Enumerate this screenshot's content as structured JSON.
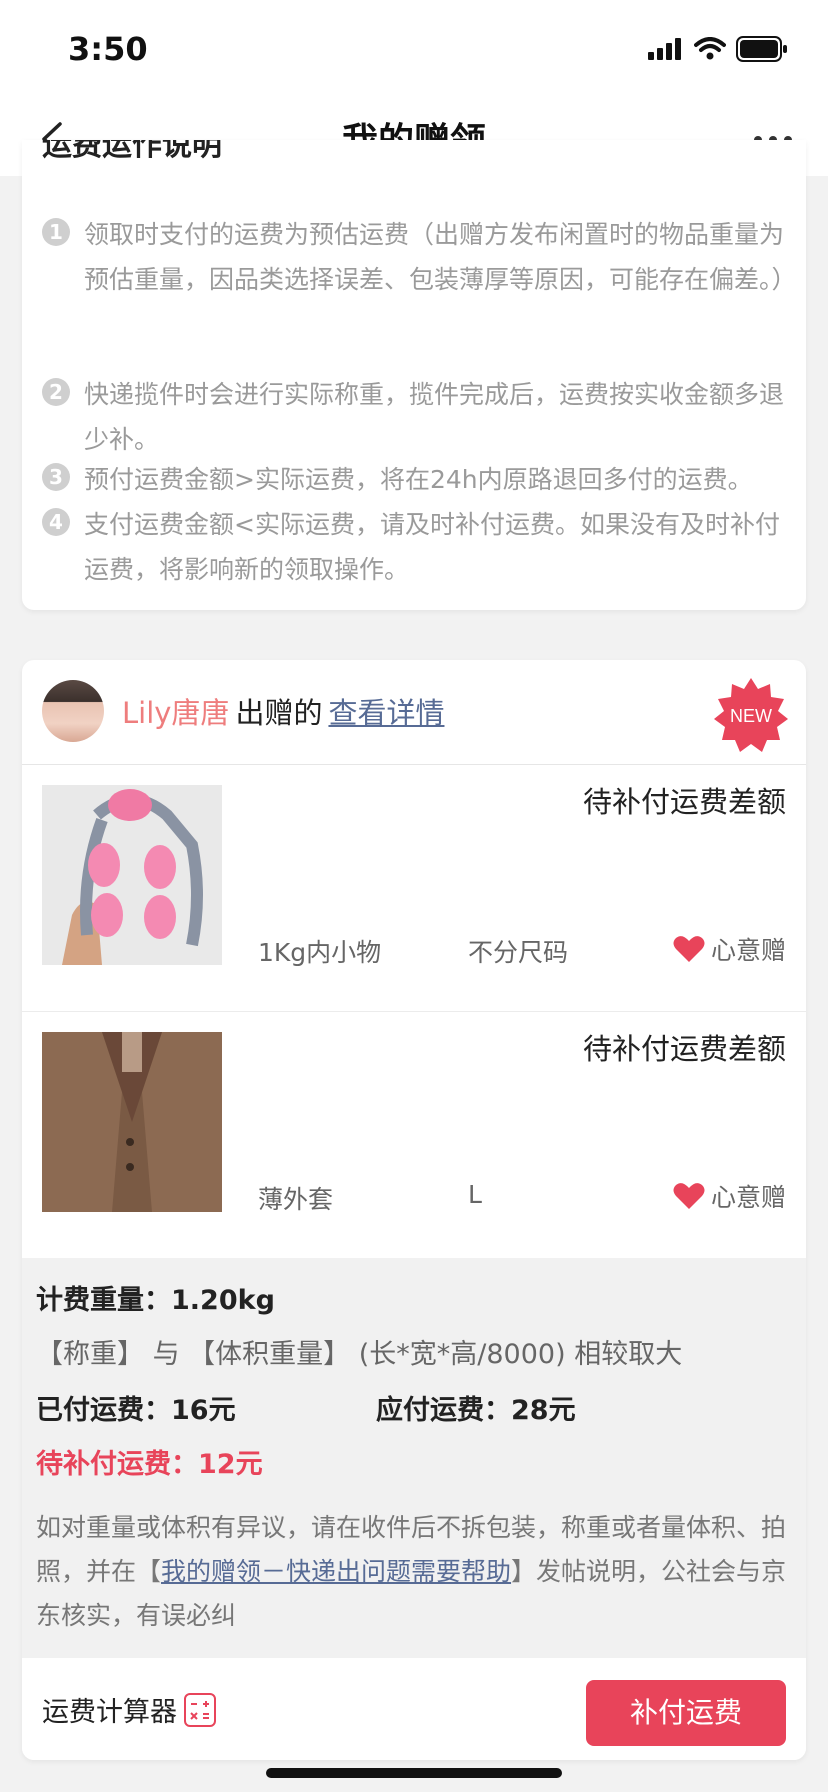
{
  "status_bar": {
    "time": "3:50"
  },
  "nav": {
    "title": "我的赠领"
  },
  "shipping_notes": {
    "title": "运费运作说明",
    "items": [
      {
        "num": "1",
        "text": "领取时支付的运费为预估运费（出赠方发布闲置时的物品重量为预估重量，因品类选择误差、包装薄厚等原因，可能存在偏差。）"
      },
      {
        "num": "2",
        "text": "快递揽件时会进行实际称重，揽件完成后，运费按实收金额多退少补。"
      },
      {
        "num": "3",
        "text": "预付运费金额>实际运费，将在24h内原路退回多付的运费。"
      },
      {
        "num": "4",
        "text": "支付运费金额<实际运费，请及时补付运费。如果没有及时补付运费，将影响新的领取操作。"
      }
    ]
  },
  "order": {
    "donor_name": "Lily唐唐",
    "donor_suffix": "出赠的",
    "detail_link": "查看详情",
    "badge": "NEW",
    "items": [
      {
        "status": "待补付运费差额",
        "name": "1Kg内小物",
        "size": "不分尺码",
        "tag": "心意赠"
      },
      {
        "status": "待补付运费差额",
        "name": "薄外套",
        "size": "L",
        "tag": "心意赠"
      }
    ],
    "fee": {
      "billing_weight_label": "计费重量：",
      "billing_weight": "1.20kg",
      "weight_rule": "【称重】 与 【体积重量】 (长*宽*高/8000) 相较取大",
      "paid_label": "已付运费：",
      "paid": "16元",
      "due_label": "应付运费：",
      "due": "28元",
      "pending_label": "待补付运费：",
      "pending": "12元",
      "desc_before": "如对重量或体积有异议，请在收件后不拆包装，称重或者量体积、拍照，并在【",
      "desc_link": "我的赠领－快递出问题需要帮助",
      "desc_after": "】发帖说明，公社会与京东核实，有误必纠"
    },
    "calculator_label": "运费计算器",
    "pay_button": "补付运费"
  },
  "colors": {
    "accent": "#e8445a",
    "link": "#576b95",
    "donor": "#ee7d7d"
  }
}
